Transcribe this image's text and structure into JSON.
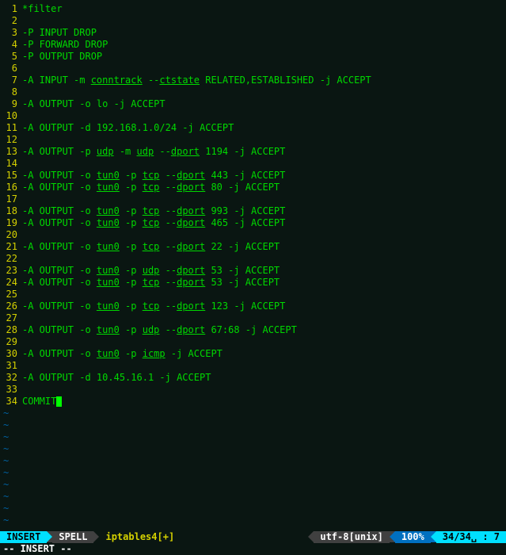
{
  "lines": [
    {
      "n": 1,
      "plain": "*filter"
    },
    {
      "n": 2,
      "plain": ""
    },
    {
      "n": 3,
      "plain": "-P INPUT DROP"
    },
    {
      "n": 4,
      "plain": "-P FORWARD DROP"
    },
    {
      "n": 5,
      "plain": "-P OUTPUT DROP"
    },
    {
      "n": 6,
      "plain": ""
    },
    {
      "n": 7,
      "segs": [
        "-A INPUT -m ",
        {
          "u": "conntrack"
        },
        " --",
        {
          "u": "ctstate"
        },
        " RELATED,ESTABLISHED -j ACCEPT"
      ]
    },
    {
      "n": 8,
      "plain": ""
    },
    {
      "n": 9,
      "plain": "-A OUTPUT -o lo -j ACCEPT"
    },
    {
      "n": 10,
      "plain": ""
    },
    {
      "n": 11,
      "plain": "-A OUTPUT -d 192.168.1.0/24 -j ACCEPT"
    },
    {
      "n": 12,
      "plain": ""
    },
    {
      "n": 13,
      "segs": [
        "-A OUTPUT -p ",
        {
          "u": "udp"
        },
        " -m ",
        {
          "u": "udp"
        },
        " --",
        {
          "u": "dport"
        },
        " 1194 -j ACCEPT"
      ]
    },
    {
      "n": 14,
      "plain": ""
    },
    {
      "n": 15,
      "segs": [
        "-A OUTPUT -o ",
        {
          "u": "tun0"
        },
        " -p ",
        {
          "u": "tcp"
        },
        " --",
        {
          "u": "dport"
        },
        " 443 -j ACCEPT"
      ]
    },
    {
      "n": 16,
      "segs": [
        "-A OUTPUT -o ",
        {
          "u": "tun0"
        },
        " -p ",
        {
          "u": "tcp"
        },
        " --",
        {
          "u": "dport"
        },
        " 80 -j ACCEPT"
      ]
    },
    {
      "n": 17,
      "plain": ""
    },
    {
      "n": 18,
      "segs": [
        "-A OUTPUT -o ",
        {
          "u": "tun0"
        },
        " -p ",
        {
          "u": "tcp"
        },
        " --",
        {
          "u": "dport"
        },
        " 993 -j ACCEPT"
      ]
    },
    {
      "n": 19,
      "segs": [
        "-A OUTPUT -o ",
        {
          "u": "tun0"
        },
        " -p ",
        {
          "u": "tcp"
        },
        " --",
        {
          "u": "dport"
        },
        " 465 -j ACCEPT"
      ]
    },
    {
      "n": 20,
      "plain": ""
    },
    {
      "n": 21,
      "segs": [
        "-A OUTPUT -o ",
        {
          "u": "tun0"
        },
        " -p ",
        {
          "u": "tcp"
        },
        " --",
        {
          "u": "dport"
        },
        " 22 -j ACCEPT"
      ]
    },
    {
      "n": 22,
      "plain": ""
    },
    {
      "n": 23,
      "segs": [
        "-A OUTPUT -o ",
        {
          "u": "tun0"
        },
        " -p ",
        {
          "u": "udp"
        },
        " --",
        {
          "u": "dport"
        },
        " 53 -j ACCEPT"
      ]
    },
    {
      "n": 24,
      "segs": [
        "-A OUTPUT -o ",
        {
          "u": "tun0"
        },
        " -p ",
        {
          "u": "tcp"
        },
        " --",
        {
          "u": "dport"
        },
        " 53 -j ACCEPT"
      ]
    },
    {
      "n": 25,
      "plain": ""
    },
    {
      "n": 26,
      "segs": [
        "-A OUTPUT -o ",
        {
          "u": "tun0"
        },
        " -p ",
        {
          "u": "tcp"
        },
        " --",
        {
          "u": "dport"
        },
        " 123 -j ACCEPT"
      ]
    },
    {
      "n": 27,
      "plain": ""
    },
    {
      "n": 28,
      "segs": [
        "-A OUTPUT -o ",
        {
          "u": "tun0"
        },
        " -p ",
        {
          "u": "udp"
        },
        " --",
        {
          "u": "dport"
        },
        " 67:68 -j ACCEPT"
      ]
    },
    {
      "n": 29,
      "plain": ""
    },
    {
      "n": 30,
      "segs": [
        "-A OUTPUT -o ",
        {
          "u": "tun0"
        },
        " -p ",
        {
          "u": "icmp"
        },
        " -j ACCEPT"
      ]
    },
    {
      "n": 31,
      "plain": ""
    },
    {
      "n": 32,
      "plain": "-A OUTPUT -d 10.45.16.1 -j ACCEPT"
    },
    {
      "n": 33,
      "plain": ""
    },
    {
      "n": 34,
      "plain": "COMMIT",
      "cursor": true
    }
  ],
  "tilde_count": 10,
  "tilde_char": "~",
  "status": {
    "mode": "INSERT",
    "spell": "SPELL",
    "filename": "iptables4[+]",
    "encoding": "utf-8[unix]",
    "percent": "100%",
    "position": "34/34␣ :  7"
  },
  "cmdline": "-- INSERT --"
}
